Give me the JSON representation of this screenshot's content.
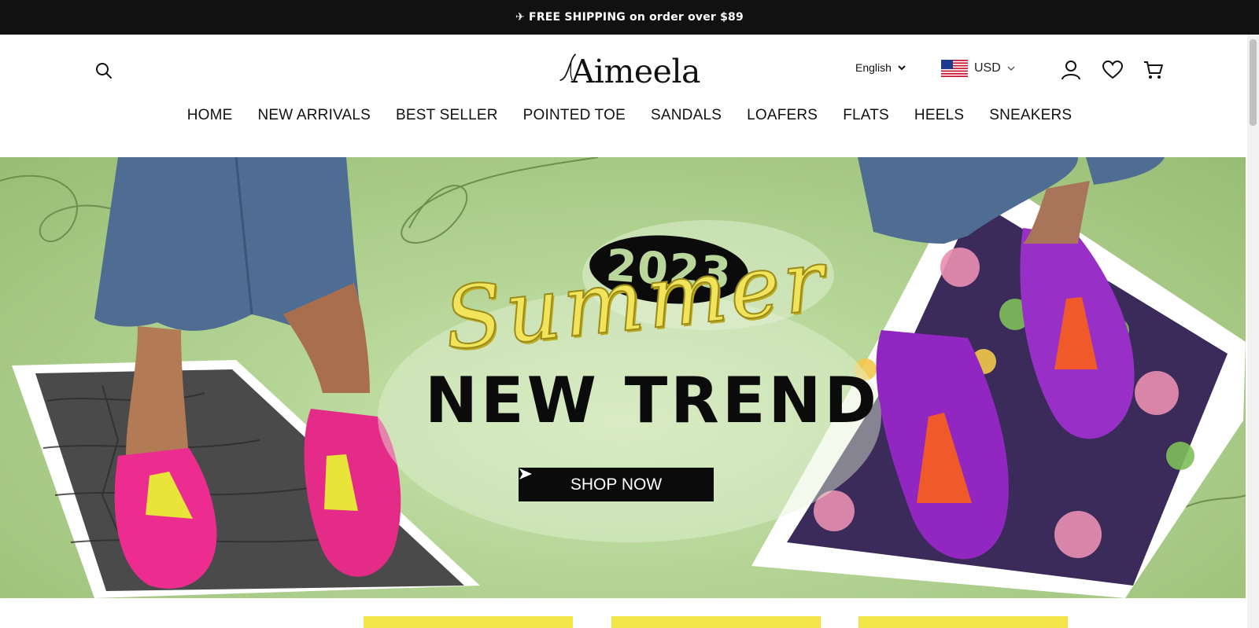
{
  "announcement": {
    "icon": "airplane-icon",
    "text": "✈ FREE SHIPPING on order over $89"
  },
  "header": {
    "logo_text": "Aimeela",
    "language": "English",
    "currency": "USD",
    "icons": {
      "search": "search-icon",
      "account": "user-icon",
      "wishlist": "heart-icon",
      "cart": "cart-icon",
      "flag": "us-flag-icon"
    }
  },
  "nav": {
    "items": [
      "HOME",
      "NEW ARRIVALS",
      "BEST SELLER",
      "POINTED TOE",
      "SANDALS",
      "LOAFERS",
      "FLATS",
      "HEELS",
      "SNEAKERS"
    ]
  },
  "hero": {
    "year": "2023",
    "script_title": "Summer",
    "headline": "NEW TREND",
    "cta_label": "SHOP NOW",
    "cta_icon": "play-arrow-icon",
    "colors": {
      "background": "#b5d596",
      "script": "#f1e45a",
      "cta": "#0b0b0b",
      "left_shoe": "#ec2d8f",
      "right_shoe": "#9126c0",
      "tassel_left": "#e8e43a",
      "tassel_right": "#f05a2a"
    }
  }
}
